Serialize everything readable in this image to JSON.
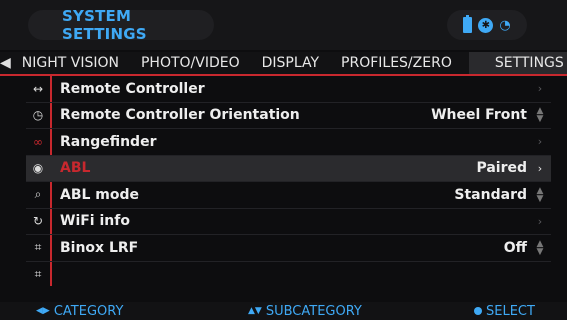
{
  "header": {
    "title": "SYSTEM SETTINGS"
  },
  "status": {
    "battery_icon": "battery-icon",
    "bluetooth_icon": "bluetooth-icon",
    "wifi_icon": "wifi-icon"
  },
  "tabs": [
    {
      "label": "NIGHT VISION"
    },
    {
      "label": "PHOTO/VIDEO"
    },
    {
      "label": "DISPLAY"
    },
    {
      "label": "PROFILES/ZERO"
    },
    {
      "label": "SETTINGS"
    }
  ],
  "active_tab": "SETTINGS",
  "rows": [
    {
      "icon": "remote-icon",
      "label": "Remote Controller",
      "value": "",
      "control": "chevron"
    },
    {
      "icon": "clock-icon",
      "label": "Remote Controller Orientation",
      "value": "Wheel Front",
      "control": "updown"
    },
    {
      "icon": "rangefinder-icon",
      "label": "Rangefinder",
      "value": "",
      "control": "chevron"
    },
    {
      "icon": "target-icon",
      "label": "ABL",
      "value": "Paired",
      "control": "chevron",
      "selected": true
    },
    {
      "icon": "search-icon",
      "label": "ABL mode",
      "value": "Standard",
      "control": "updown"
    },
    {
      "icon": "refresh-icon",
      "label": "WiFi info",
      "value": "",
      "control": "chevron"
    },
    {
      "icon": "chip-icon",
      "label": "Binox LRF",
      "value": "Off",
      "control": "updown"
    },
    {
      "icon": "chip-icon",
      "label": "",
      "value": "",
      "control": "none"
    }
  ],
  "footer": {
    "category": "CATEGORY",
    "subcategory": "SUBCATEGORY",
    "select": "SELECT"
  },
  "colors": {
    "accent": "#3fa9f5",
    "highlight": "#c8282e",
    "background": "#0d0d0f"
  }
}
